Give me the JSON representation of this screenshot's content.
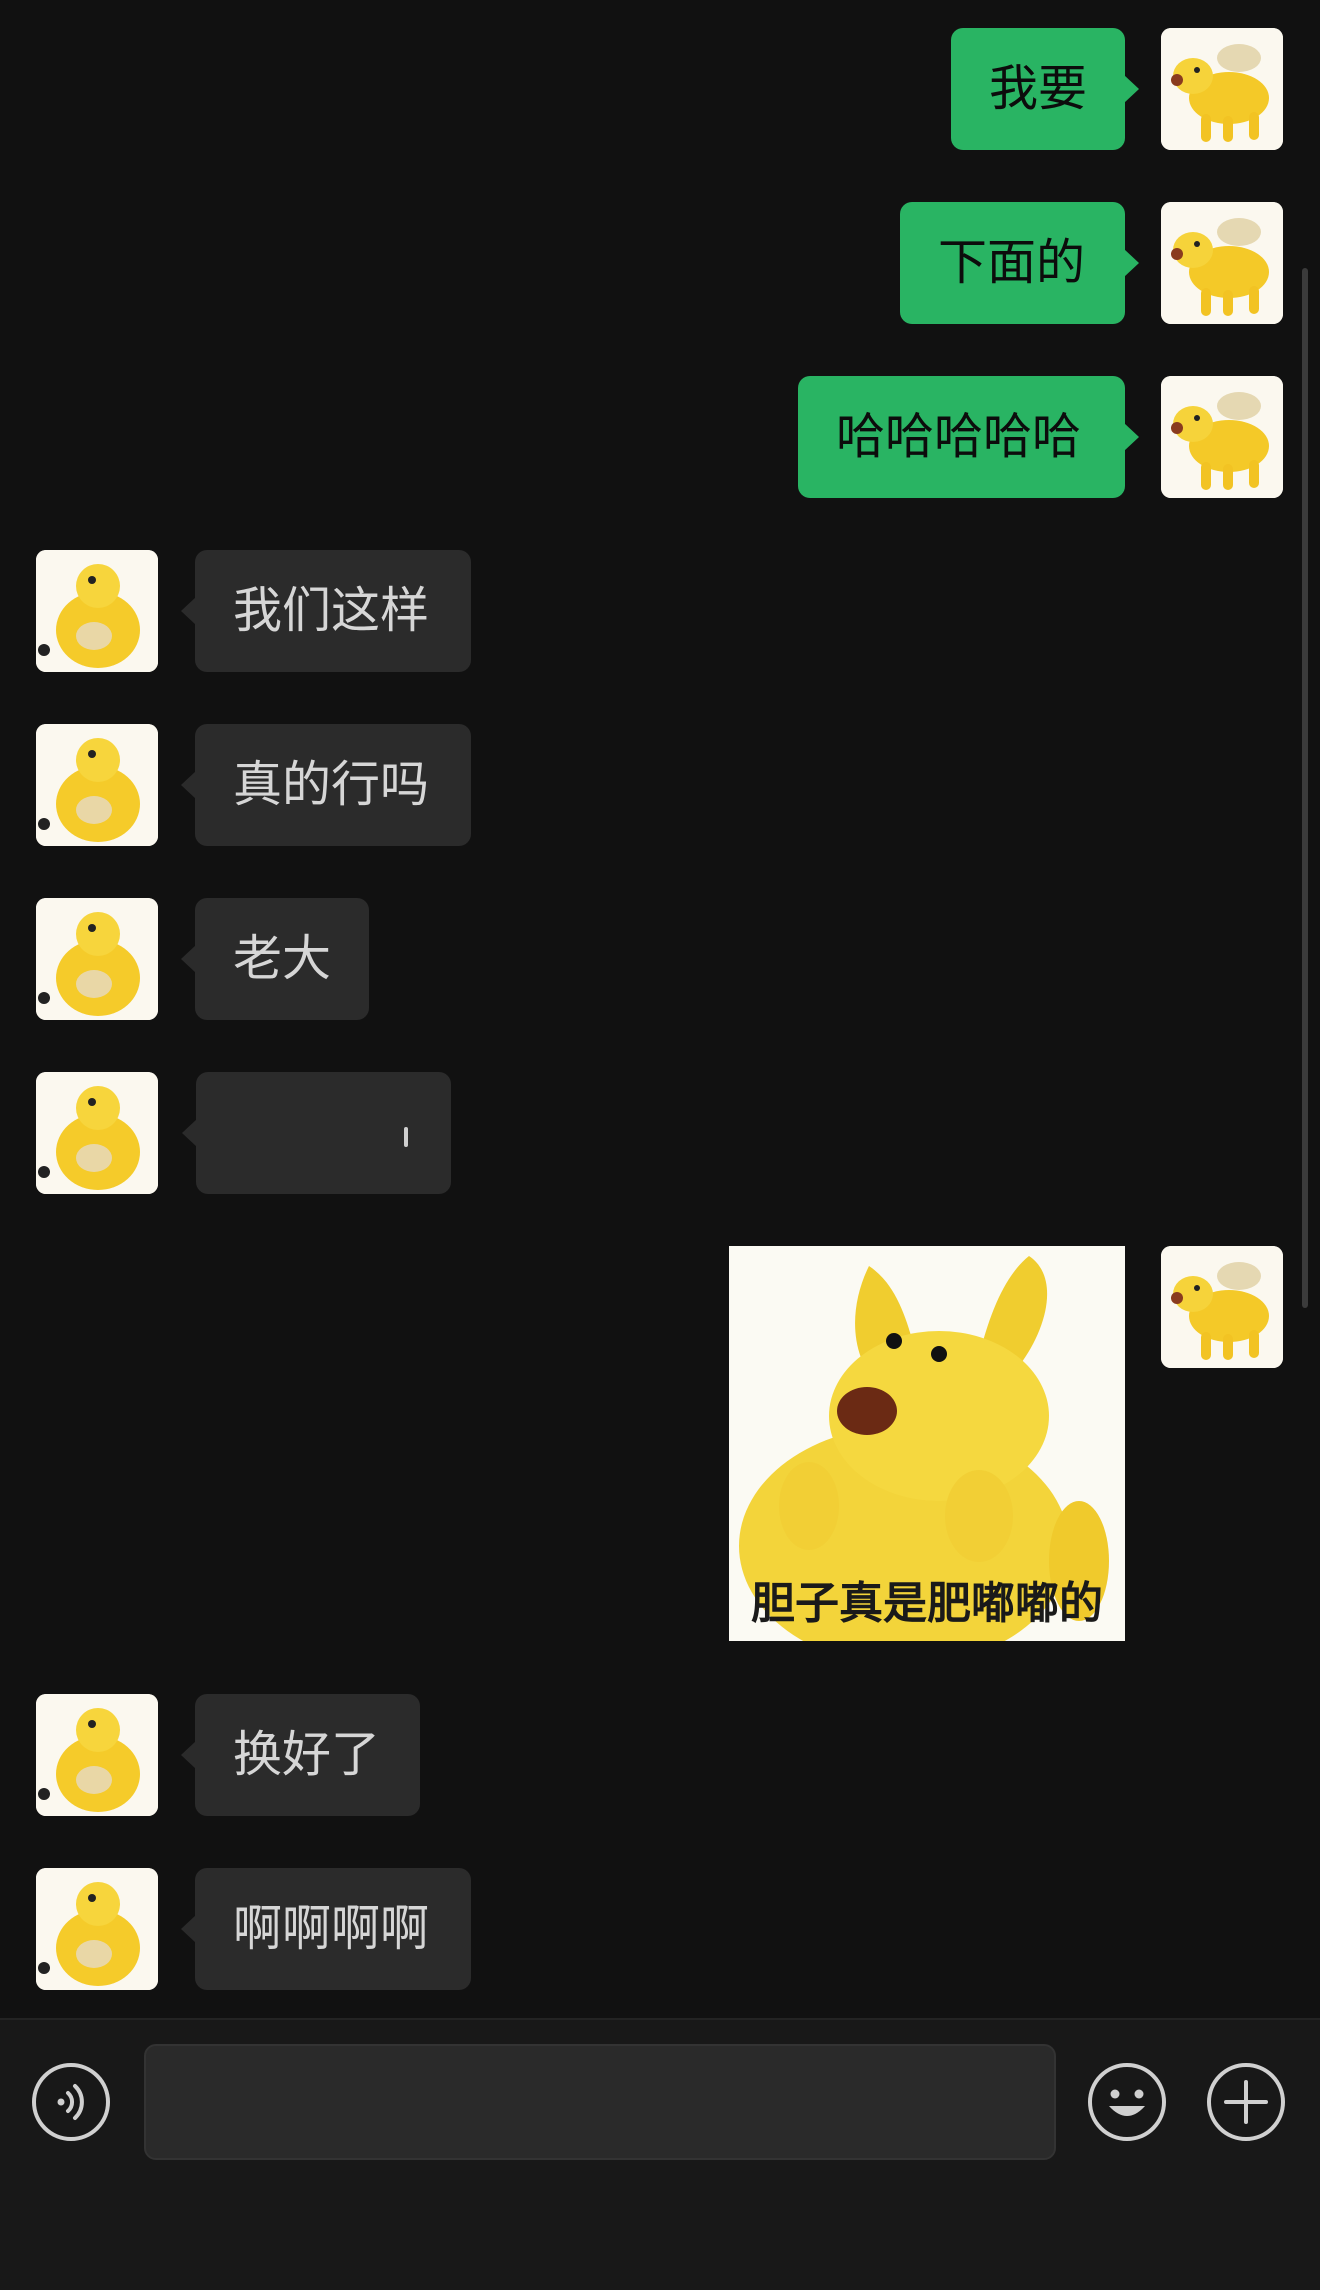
{
  "messages": [
    {
      "side": "me",
      "text": "我要"
    },
    {
      "side": "me",
      "text": "下面的"
    },
    {
      "side": "me",
      "text": "哈哈哈哈哈"
    },
    {
      "side": "them",
      "text": "我们这样"
    },
    {
      "side": "them",
      "text": "真的行吗"
    },
    {
      "side": "them",
      "text": "老大"
    },
    {
      "side": "them",
      "text": ""
    },
    {
      "side": "me",
      "sticker_caption": "胆子真是肥嘟嘟的"
    },
    {
      "side": "them",
      "text": "换好了"
    },
    {
      "side": "them",
      "text": "啊啊啊啊"
    }
  ],
  "input": {
    "value": "",
    "placeholder": ""
  },
  "icons": {
    "voice": "voice-icon",
    "emoji": "emoji-icon",
    "plus": "plus-icon"
  },
  "colors": {
    "background": "#111111",
    "my_bubble": "#29b463",
    "their_bubble": "#2b2b2b"
  }
}
